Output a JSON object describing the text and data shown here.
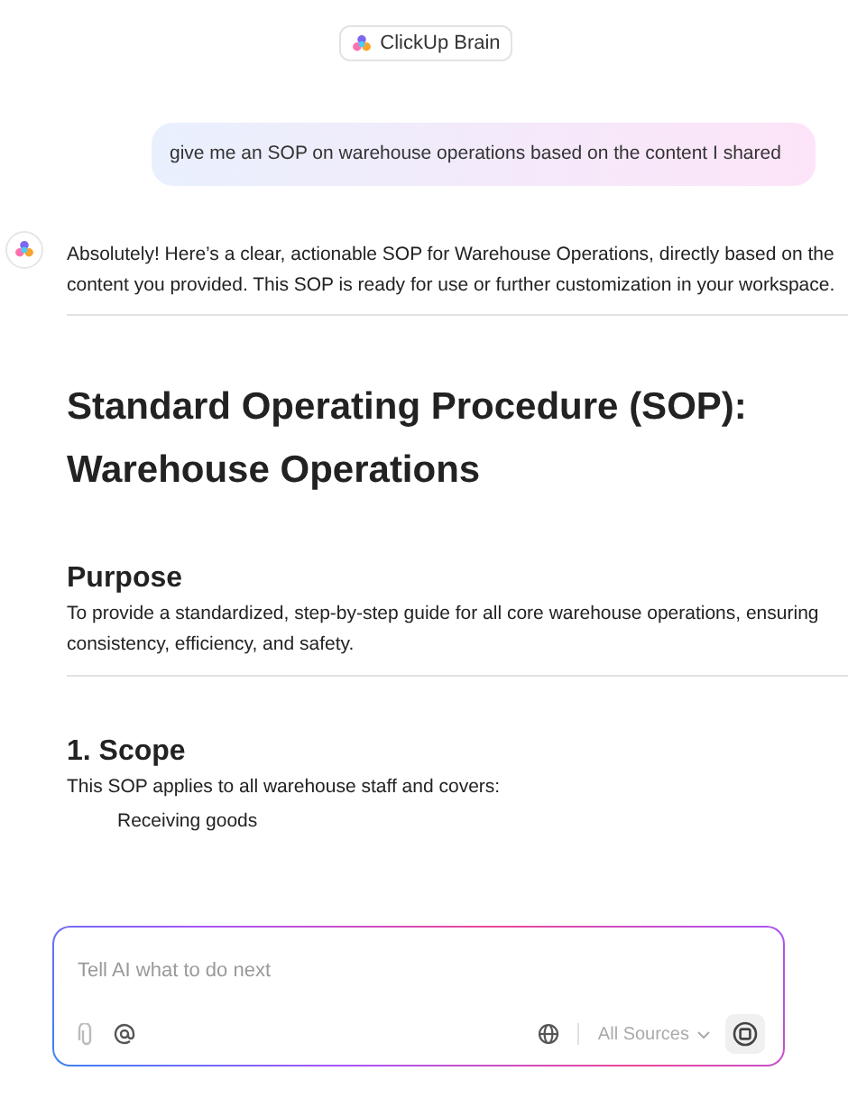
{
  "header": {
    "title": "ClickUp Brain"
  },
  "user_message": "give me an SOP on warehouse operations based on the content I shared",
  "assistant": {
    "intro": "Absolutely! Here’s a clear, actionable SOP for Warehouse Operations, directly based on the content you provided. This SOP is ready for use or further customization in your workspace.",
    "title": "Standard Operating Procedure (SOP): Warehouse Operations",
    "sections": [
      {
        "heading": "Purpose",
        "text": "To provide a standardized, step-by-step guide for all core warehouse operations, ensuring consistency, efficiency, and safety."
      },
      {
        "heading": "1. Scope",
        "text": "This SOP applies to all warehouse staff and covers:",
        "items": [
          "Receiving goods"
        ]
      }
    ]
  },
  "composer": {
    "placeholder": "Tell AI what to do next",
    "sources": "All Sources"
  }
}
